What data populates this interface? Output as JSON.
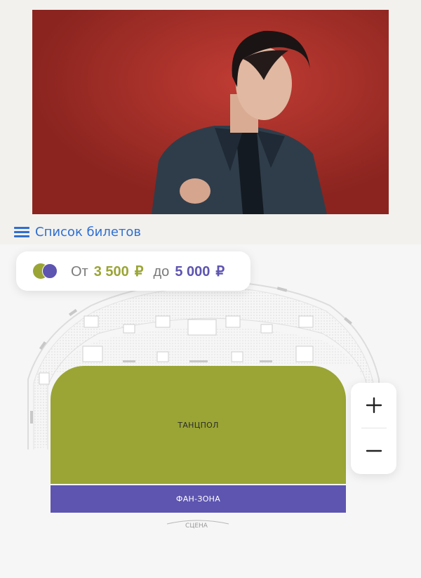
{
  "event": {
    "photo_alt_icon": "artist-photo"
  },
  "tickets_link": {
    "icon": "hamburger-icon",
    "label": "Список билетов"
  },
  "price_range": {
    "from_label": "От",
    "from_value": "3 500",
    "to_label": "до",
    "to_value": "5 000",
    "currency": "₽",
    "colors": {
      "low": "#9aa535",
      "high": "#5d55b0"
    }
  },
  "map": {
    "zones": [
      {
        "label": "ТАНЦПОЛ",
        "color": "#9aa535"
      },
      {
        "label": "ФАН-ЗОНА",
        "color": "#5d55b0"
      }
    ],
    "stage_label": "СЦЕНА"
  },
  "zoom": {
    "zoom_in_icon": "plus-icon",
    "zoom_out_icon": "minus-icon"
  }
}
